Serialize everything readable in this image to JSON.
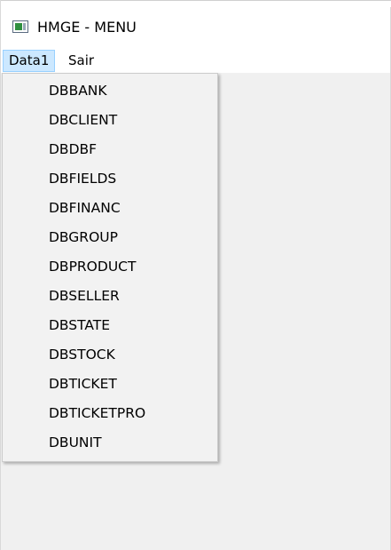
{
  "window": {
    "title": "HMGE - MENU",
    "icon": "app-window-icon"
  },
  "menubar": {
    "items": [
      {
        "label": "Data1",
        "open": true
      },
      {
        "label": "Sair",
        "open": false
      }
    ]
  },
  "dropdown": {
    "items": [
      {
        "label": "DBBANK"
      },
      {
        "label": "DBCLIENT"
      },
      {
        "label": "DBDBF"
      },
      {
        "label": "DBFIELDS"
      },
      {
        "label": "DBFINANC"
      },
      {
        "label": "DBGROUP"
      },
      {
        "label": "DBPRODUCT"
      },
      {
        "label": "DBSELLER"
      },
      {
        "label": "DBSTATE"
      },
      {
        "label": "DBSTOCK"
      },
      {
        "label": "DBTICKET"
      },
      {
        "label": "DBTICKETPRO"
      },
      {
        "label": "DBUNIT"
      }
    ]
  },
  "colors": {
    "open_menu_highlight": "#cce8ff",
    "open_menu_border": "#99d1ff",
    "client_background": "#f0f0f0",
    "dropdown_background": "#f2f2f2"
  }
}
